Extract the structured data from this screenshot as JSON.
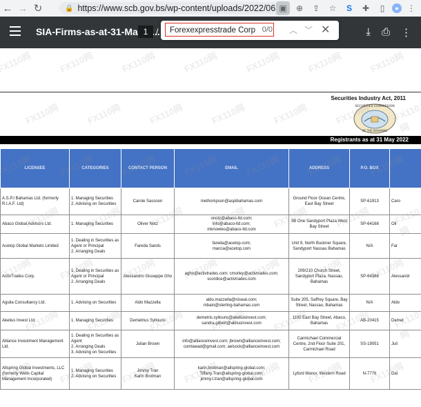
{
  "browser": {
    "url": "https://www.scb.gov.bs/wp-content/uploads/2022/06..."
  },
  "pdf_toolbar": {
    "title": "SIA-Firms-as-at-31-May-2...",
    "page_current": "1",
    "page_sep": "/ 2"
  },
  "find_bar": {
    "query": "Forexexpresstrade Corp",
    "count": "0/0"
  },
  "document": {
    "act_title": "Securities Industry Act, 2011",
    "seal_text_top": "SECURITIES COMMISSION",
    "seal_text_bottom": "OF THE BAHAMAS",
    "registrants_label": "Registrants as at 31 May 2022",
    "watermark": "FX110网",
    "columns": [
      "LICENSEE",
      "CATEGORIES",
      "CONTACT PERSON",
      "EMAIL",
      "ADDRESS",
      "P.O. BOX",
      ""
    ],
    "rows": [
      {
        "licensee": "A.S.P.I Bahamas Ltd. (formerly R.I.A.F. Ltd)",
        "categories": "1. Managing Securities\n2. Advising on Securities",
        "contact": "Carole Sassoon",
        "email": "methompson@aspibahamas.com",
        "address": "Ground Floor Ocean Centre,\nEast Bay Street",
        "pobox": "SP-61913",
        "extra": "Caro"
      },
      {
        "licensee": "Abaco Global Advisors Ltd.",
        "categories": "1. Managing Securities",
        "contact": "Oliver Notz",
        "email": "onotz@abaco-ltd.com;\ninfo@abaco-ltd.com;\nmknowles@abaco-ltd.com",
        "address": "3B One Sandyport Plaza West\nBay Street",
        "pobox": "SP-64168",
        "extra": "Oli"
      },
      {
        "licensee": "Acetop Global Markets Limited",
        "categories": "1. Dealing in Securities as\nAgent or Principal\n2. Arranging Deals",
        "contact": "Fareda Sands",
        "email": "fareda@acetop.com;\nmarcia@acetop.com",
        "address": "Unit 9, North Buckner Square,\nSandyport Nassau Bahamas",
        "pobox": "N/A",
        "extra": "Far"
      },
      {
        "licensee": "ActivTrades Corp.",
        "categories": "1. Dealing in Securities as\nAgent or Principal\n2. Arranging Deals",
        "contact": "Alessandro Giuseppe Gho",
        "email": "agho@activtrades.com; cmorley@activtrades.com;\nscordice@activtrades.com",
        "address": "209/210 Church Street,\nSandyport Plaza, Nassau,\nBahamas",
        "pobox": "SP-64388",
        "extra": "Alessandr"
      },
      {
        "licensee": "Aguila Consultancy Ltd.",
        "categories": "1. Advising on Securities",
        "contact": "Aldo Mazzella",
        "email": "aldo.mazzella@niswal.com;\nmbain@sterling-bahamas.com",
        "address": "Suite 205, Saffrey Square, Bay\nStreet, Nassau, Bahamas",
        "pobox": "N/A",
        "extra": "Aldo"
      },
      {
        "licensee": "Akelius Invest Ltd.",
        "categories": "1. Managing Securities",
        "contact": "Demetrius Syllouris",
        "email": "demetris.syllouris@akeliusinvest.com;\nsandra.gilbert@akliusinvest.com",
        "address": "1100 East Bay Street, Abaco,\nBahamas",
        "pobox": "AB-20415",
        "extra": "Demet"
      },
      {
        "licensee": "Alliance Investment Management Ltd.",
        "categories": "1. Dealing in Securities as\nAgent\n2. Arranging Deals\n3. Advising on Securities",
        "contact": "Julian Brown",
        "email": "info@allianceinvest.com; jbrown@allianceinvest.com;\ncomlawad@gmail.com; aelsock@allianceinvest.com",
        "address": "Carmichael Commercial\nCentre, 2nd Floor Suite 201,\nCarmichael Road",
        "pobox": "SS-19051",
        "extra": "Juli"
      },
      {
        "licensee": "Allspring Global Investments, LLC\n(formerly Wells Capital\nManagement Incorporated)",
        "categories": "1. Managing Securities\n2. Advising on Securities",
        "contact": "Jimmy Tran\nKarin Brotman",
        "email": "karin.brotman@allspring-global.com;\nTiffany.Tran@allspring-global.com;\njimmy.t.tran@allspring-global.com",
        "address": "Lyford Manor, Western Road",
        "pobox": "N-7776",
        "extra": "Dal"
      }
    ]
  }
}
